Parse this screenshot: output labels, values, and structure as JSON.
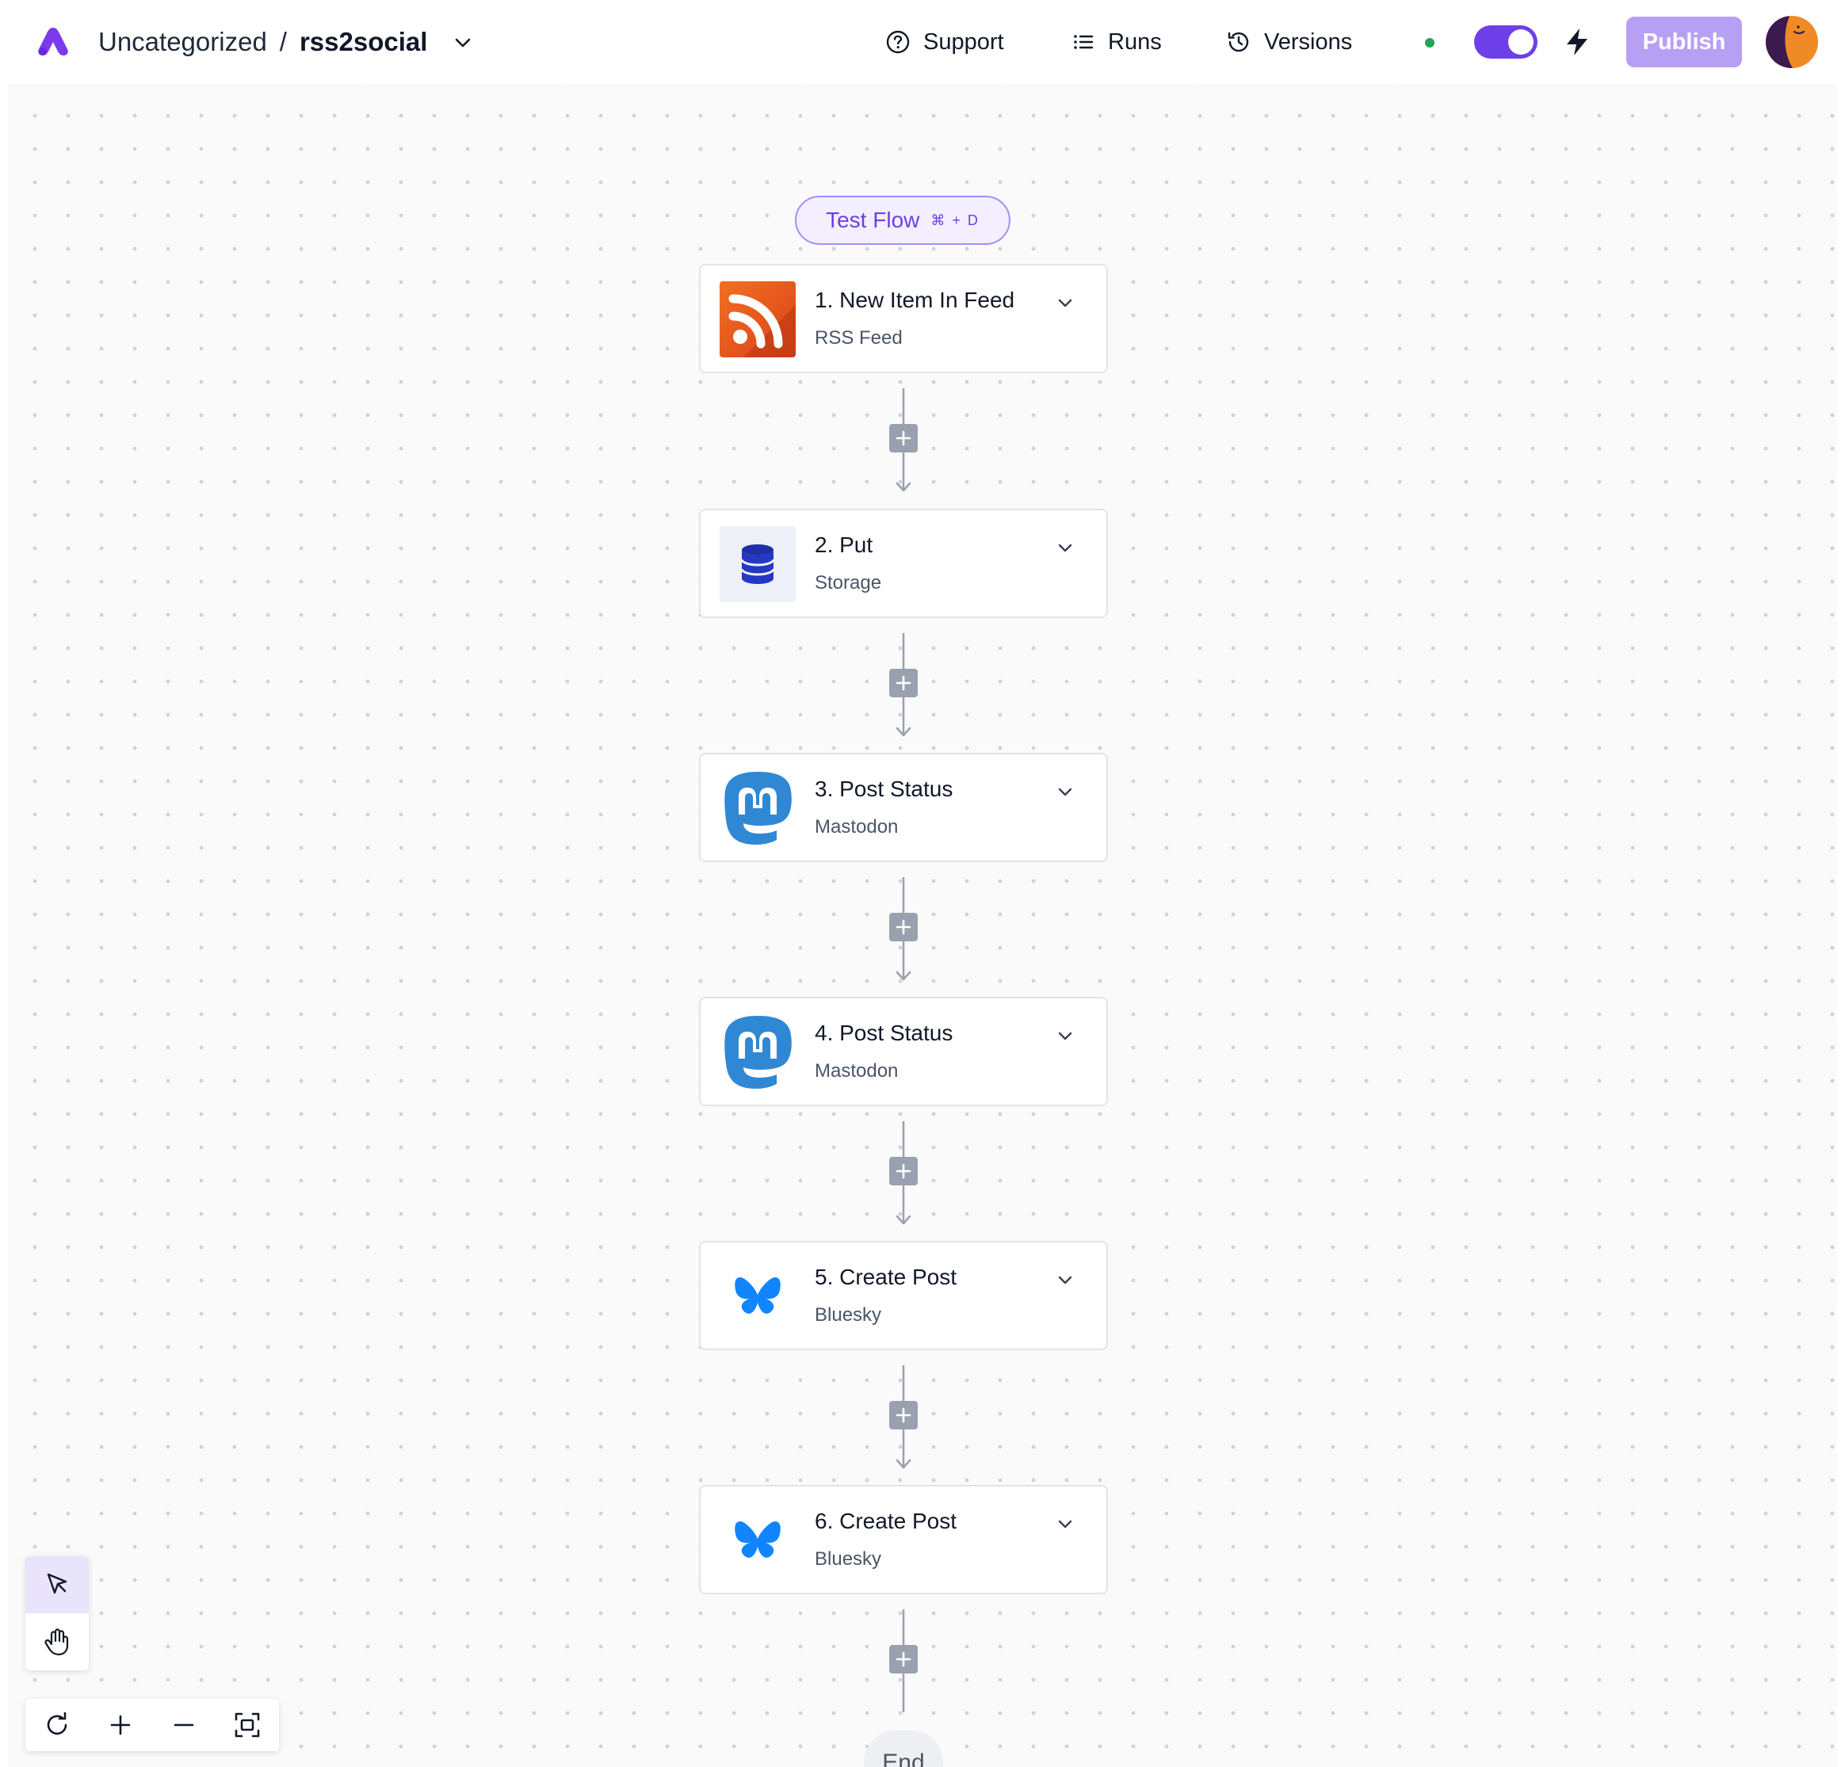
{
  "header": {
    "project": "Uncategorized",
    "separator": "/",
    "flow_name": "rss2social",
    "support_label": "Support",
    "runs_label": "Runs",
    "versions_label": "Versions",
    "publish_label": "Publish",
    "flow_enabled": true,
    "colors": {
      "brand": "#6d3fe8",
      "publish_bg": "#b7a0f4",
      "status_dot": "#22a35a"
    }
  },
  "canvas": {
    "test_flow_label": "Test Flow",
    "test_flow_shortcut": "⌘ + D",
    "end_label": "End",
    "steps": [
      {
        "title": "1. New Item In Feed",
        "subtitle": "RSS Feed",
        "icon": "rss-icon"
      },
      {
        "title": "2. Put",
        "subtitle": "Storage",
        "icon": "database-icon"
      },
      {
        "title": "3. Post Status",
        "subtitle": "Mastodon",
        "icon": "mastodon-icon"
      },
      {
        "title": "4. Post Status",
        "subtitle": "Mastodon",
        "icon": "mastodon-icon"
      },
      {
        "title": "5. Create Post",
        "subtitle": "Bluesky",
        "icon": "bluesky-icon"
      },
      {
        "title": "6. Create Post",
        "subtitle": "Bluesky",
        "icon": "bluesky-icon"
      }
    ]
  },
  "tools": {
    "mode_buttons": [
      "pointer-icon",
      "hand-icon"
    ],
    "active_mode": "pointer-icon",
    "zoom_buttons": [
      "refresh-icon",
      "zoom-in-icon",
      "zoom-out-icon",
      "fit-view-icon"
    ]
  }
}
